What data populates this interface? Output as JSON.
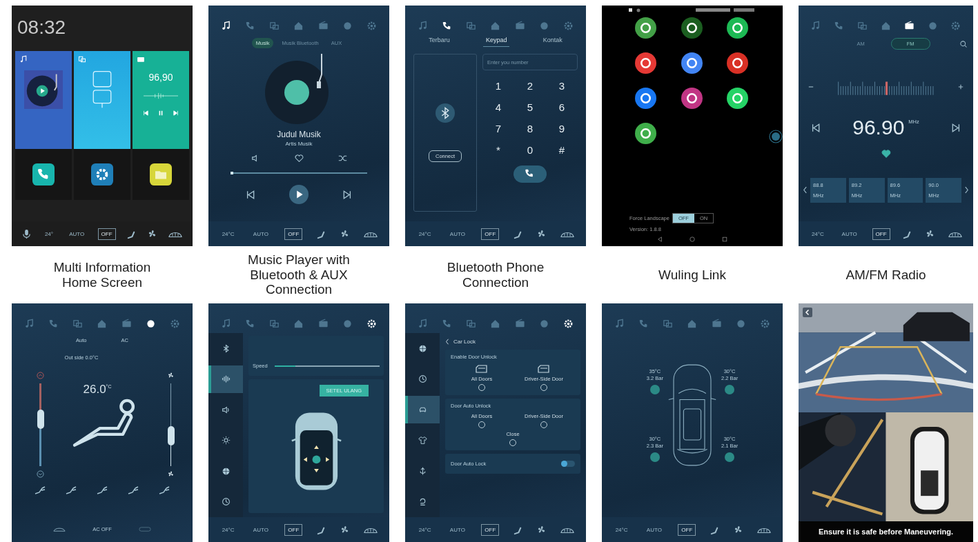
{
  "screens": [
    {
      "kind": "home",
      "caption": "Multi Information Home Screen",
      "clock": "08:32",
      "radio_value": "96,90",
      "bar": {
        "temp": "24°",
        "auto": "AUTO",
        "off": "OFF"
      }
    },
    {
      "kind": "music",
      "caption": "Music Player with Bluetooth & AUX Connection",
      "nav": [
        {
          "selected": true
        },
        {
          "selected": false
        },
        {
          "selected": false
        },
        {
          "selected": false
        },
        {
          "selected": false
        },
        {
          "selected": false
        },
        {
          "selected": false
        }
      ],
      "sources": [
        {
          "label": "Musik",
          "selected": true
        },
        {
          "label": "Musik Bluetooth",
          "selected": false
        },
        {
          "label": "AUX",
          "selected": false
        }
      ],
      "title": "Judul Musik",
      "artist": "Artis Musik",
      "progress": {
        "level": 0.02
      },
      "bar": {
        "temp": "24°C",
        "auto": "AUTO",
        "off": "OFF"
      }
    },
    {
      "kind": "phone",
      "caption": "Bluetooth Phone Connection",
      "nav": [
        {
          "selected": false
        },
        {
          "selected": true
        },
        {
          "selected": false
        },
        {
          "selected": false
        },
        {
          "selected": false
        },
        {
          "selected": false
        },
        {
          "selected": false
        }
      ],
      "tabs": [
        {
          "label": "Terbaru",
          "selected": false
        },
        {
          "label": "Keypad",
          "selected": true
        },
        {
          "label": "Kontak",
          "selected": false
        }
      ],
      "connect": "Connect",
      "placeholder": "Enter you number",
      "keys": [
        "1",
        "2",
        "3",
        "4",
        "5",
        "6",
        "7",
        "8",
        "9",
        "*",
        "0",
        "#"
      ],
      "bar": {
        "temp": "24°C",
        "auto": "AUTO",
        "off": "OFF"
      }
    },
    {
      "kind": "apps",
      "caption": "Wuling Link",
      "apps": [
        {
          "color": "#43a047"
        },
        {
          "color": "#1b5e20"
        },
        {
          "color": "#1db954"
        },
        {
          "color": "#e53935"
        },
        {
          "color": "#4285f4"
        },
        {
          "color": "#d93025"
        },
        {
          "color": "#1877f2"
        },
        {
          "color": "#c13584"
        },
        {
          "color": "#25d366"
        },
        {
          "color": "#3fae4a"
        }
      ],
      "force_landscape": {
        "label": "Force Landscape",
        "options": [
          {
            "label": "OFF",
            "selected": true
          },
          {
            "label": "ON",
            "selected": false
          }
        ]
      },
      "version": "Version: 1.8.8"
    },
    {
      "kind": "radio",
      "caption": "AM/FM Radio",
      "nav": [
        {
          "selected": false
        },
        {
          "selected": false
        },
        {
          "selected": false
        },
        {
          "selected": false
        },
        {
          "selected": true
        },
        {
          "selected": false
        },
        {
          "selected": false
        }
      ],
      "bands": [
        {
          "label": "AM",
          "selected": false
        },
        {
          "label": "FM",
          "selected": true
        }
      ],
      "frequency": "96.90",
      "unit": "MHz",
      "favorite": true,
      "presets": [
        {
          "value": "88.8",
          "unit": "MHz"
        },
        {
          "value": "89.2",
          "unit": "MHz"
        },
        {
          "value": "89.6",
          "unit": "MHz"
        },
        {
          "value": "90.0",
          "unit": "MHz"
        }
      ],
      "bar": {
        "temp": "24°C",
        "auto": "AUTO",
        "off": "OFF"
      }
    },
    {
      "kind": "climate",
      "nav": [
        {
          "selected": false
        },
        {
          "selected": false
        },
        {
          "selected": false
        },
        {
          "selected": false
        },
        {
          "selected": false
        },
        {
          "selected": true
        },
        {
          "selected": false
        }
      ],
      "modes": [
        {
          "label": "Auto",
          "selected": false
        },
        {
          "label": "AC",
          "selected": false
        }
      ],
      "outside": "Out side 0.0°C",
      "temperature": "26.0",
      "temp_unit": "°C",
      "temp_slider": {
        "level": 0.45
      },
      "fan_slider": {
        "level": 0.25
      },
      "ac_status": "AC OFF"
    },
    {
      "kind": "sound",
      "nav": [
        {
          "selected": false
        },
        {
          "selected": false
        },
        {
          "selected": false
        },
        {
          "selected": false
        },
        {
          "selected": false
        },
        {
          "selected": false
        },
        {
          "selected": true
        }
      ],
      "menu": [
        {
          "selected": false
        },
        {
          "selected": true
        },
        {
          "selected": false
        },
        {
          "selected": false
        },
        {
          "selected": false
        },
        {
          "selected": false
        }
      ],
      "speed_label": "Speed",
      "speed": {
        "level": 0.2
      },
      "reset": "SETEL ULANG",
      "bar": {
        "temp": "24°C",
        "auto": "AUTO",
        "off": "OFF"
      }
    },
    {
      "kind": "carlock",
      "nav": [
        {
          "selected": false
        },
        {
          "selected": false
        },
        {
          "selected": false
        },
        {
          "selected": false
        },
        {
          "selected": false
        },
        {
          "selected": false
        },
        {
          "selected": true
        }
      ],
      "menu": [
        {
          "selected": false
        },
        {
          "selected": false
        },
        {
          "selected": true
        },
        {
          "selected": false
        },
        {
          "selected": false
        },
        {
          "selected": false
        }
      ],
      "back_title": "Car Lock",
      "sections": [
        {
          "kind": "door-icons",
          "title": "Enable Door Unlock",
          "options": [
            {
              "label": "All Doors",
              "selected": false
            },
            {
              "label": "Driver-Side Door",
              "selected": false
            }
          ]
        },
        {
          "kind": "radios",
          "title": "Door Auto Unlock",
          "options": [
            {
              "label": "All Doors",
              "selected": false
            },
            {
              "label": "Driver-Side Door",
              "selected": false
            },
            {
              "label": "Close",
              "selected": false
            }
          ]
        },
        {
          "kind": "toggle",
          "title": "Door Auto Lock",
          "on": false
        }
      ],
      "bar": {
        "temp": "24°C",
        "auto": "AUTO",
        "off": "OFF"
      }
    },
    {
      "kind": "tire",
      "nav": [
        {
          "selected": false
        },
        {
          "selected": false
        },
        {
          "selected": false
        },
        {
          "selected": false
        },
        {
          "selected": false
        },
        {
          "selected": false
        },
        {
          "selected": false
        }
      ],
      "tires": [
        {
          "temp": "35°C",
          "pressure": "3.2 Bar"
        },
        {
          "temp": "30°C",
          "pressure": "2.2 Bar"
        },
        {
          "temp": "30°C",
          "pressure": "2.3 Bar"
        },
        {
          "temp": "30°C",
          "pressure": "2.1 Bar"
        }
      ],
      "bar": {
        "temp": "24°C",
        "auto": "AUTO",
        "off": "OFF"
      }
    },
    {
      "kind": "camera",
      "notice": "Ensure it is safe before Maneuvering."
    }
  ]
}
